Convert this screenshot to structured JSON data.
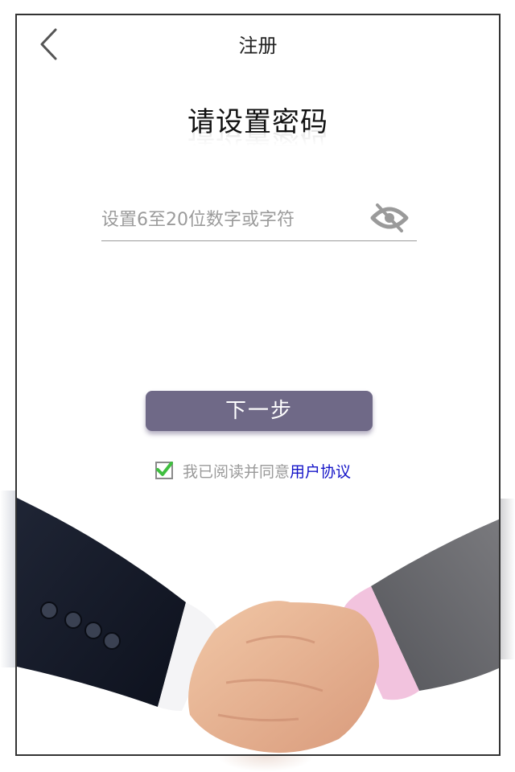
{
  "header": {
    "title": "注册",
    "back_icon": "chevron-left-icon"
  },
  "heading": "请设置密码",
  "password": {
    "placeholder": "设置6至20位数字或字符",
    "value": "",
    "toggle_icon": "eye-off-icon"
  },
  "next_button": "下一步",
  "agreement": {
    "checked": true,
    "text": "我已阅读并同意",
    "link": "用户协议",
    "link_color": "#1414c8"
  },
  "colors": {
    "button": "#6f6987",
    "checkmark": "#3fbf3f"
  },
  "illustration": "handshake-image"
}
